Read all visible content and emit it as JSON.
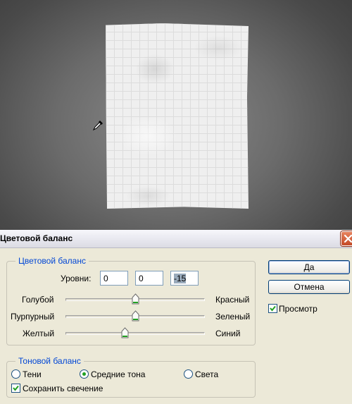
{
  "dialog": {
    "title": "Цветовой баланс",
    "color_balance_group": {
      "legend": "Цветовой баланс",
      "levels_label": "Уровни:",
      "levels": [
        "0",
        "0",
        "-15"
      ],
      "sliders": [
        {
          "left": "Голубой",
          "right": "Красный",
          "value": 0
        },
        {
          "left": "Пурпурный",
          "right": "Зеленый",
          "value": 0
        },
        {
          "left": "Желтый",
          "right": "Синий",
          "value": -15
        }
      ]
    },
    "tone_balance_group": {
      "legend": "Тоновой баланс",
      "options": [
        "Тени",
        "Средние тона",
        "Света"
      ],
      "selected": "Средние тона",
      "preserve_luminosity_label": "Сохранить свечение",
      "preserve_luminosity": true
    },
    "buttons": {
      "ok": "Да",
      "cancel": "Отмена"
    },
    "preview_label": "Просмотр",
    "preview": true
  }
}
